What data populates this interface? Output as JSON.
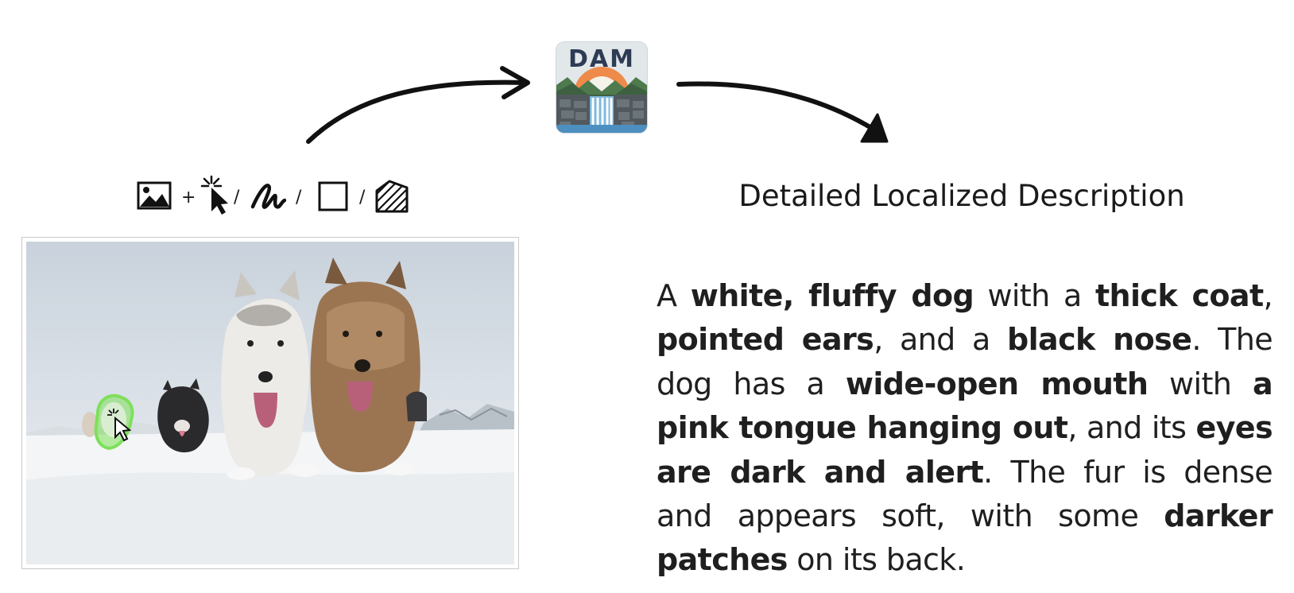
{
  "logo": {
    "text": "DAM"
  },
  "prompt_icons": [
    "image-icon",
    "click-point-icon",
    "scribble-icon",
    "box-icon",
    "mask-icon"
  ],
  "prompt_separators": {
    "plus": "+",
    "slash": "/"
  },
  "output_title": "Detailed Localized Description",
  "description": [
    {
      "t": "A ",
      "b": false
    },
    {
      "t": "white, fluffy dog",
      "b": true
    },
    {
      "t": " with a ",
      "b": false
    },
    {
      "t": "thick coat",
      "b": true
    },
    {
      "t": ", ",
      "b": false
    },
    {
      "t": "pointed ears",
      "b": true
    },
    {
      "t": ", and a ",
      "b": false
    },
    {
      "t": "black nose",
      "b": true
    },
    {
      "t": ". The dog has a ",
      "b": false
    },
    {
      "t": "wide-open mouth",
      "b": true
    },
    {
      "t": " with ",
      "b": false
    },
    {
      "t": "a pink tongue hanging out",
      "b": true
    },
    {
      "t": ", and its ",
      "b": false
    },
    {
      "t": "eyes are dark and alert",
      "b": true
    },
    {
      "t": ". The fur is dense and appears soft, with some ",
      "b": false
    },
    {
      "t": "darker patches",
      "b": true
    },
    {
      "t": " on its back.",
      "b": false
    }
  ],
  "colors": {
    "highlight": "#7ee05a",
    "logo_sun": "#ee8a4a",
    "logo_text": "#2d3b55"
  }
}
